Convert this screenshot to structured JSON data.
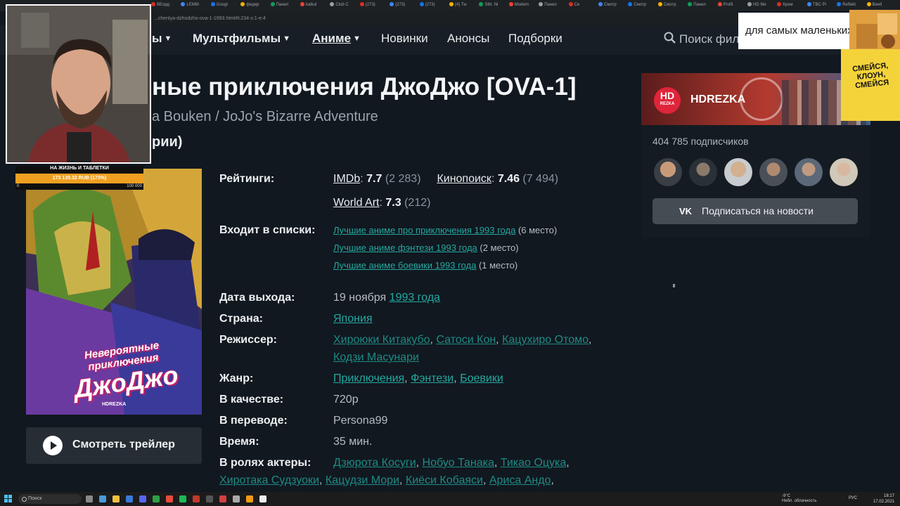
{
  "browser": {
    "tabs": [
      "ВЕорд",
      "LEMM",
      "Googl",
      "федер",
      "Панел",
      "kalkul",
      "Club C",
      "(273)",
      "(273)",
      "(273)",
      "(4) Tw",
      "Stllr. Ni",
      "Modern",
      "Панел",
      "Се",
      "Смотр",
      "Смотр",
      "Смотр",
      "Панел",
      "Profil",
      "HD Ме",
      "Крем",
      "TBC Pl",
      "Reflekt",
      "Beetl"
    ],
    "url": "...chenlya-dzhodzho-ova-1-1993.html#t:234-s:1-e:4"
  },
  "nav": {
    "item_cut": "ы",
    "cartoons": "Мультфильмы",
    "anime": "Аниме",
    "new": "Новинки",
    "announcements": "Анонсы",
    "collections": "Подборки",
    "search_placeholder": "Поиск фил"
  },
  "page": {
    "title": "ные приключения ДжоДжо [OVA-1]",
    "orig_title": "a Bouken / JoJo's Bizarre Adventure",
    "series": "рии)"
  },
  "poster": {
    "title_line1": "Невероятные",
    "title_line2": "приключения",
    "title_line3": "ДжоДжо",
    "watermark": "HDREZKA"
  },
  "trailer": {
    "label": "Смотреть трейлер"
  },
  "info": {
    "ratings_label": "Рейтинги:",
    "imdb": {
      "name": "IMDb",
      "score": "7.7",
      "votes": "(2 283)"
    },
    "kp": {
      "name": "Кинопоиск",
      "score": "7.46",
      "votes": "(7 494)"
    },
    "worldart": {
      "name": "World Art",
      "score": "7.3",
      "votes": "(212)"
    },
    "lists_label": "Входит в списки:",
    "lists": [
      {
        "title": "Лучшие аниме про приключения 1993 года",
        "place": "(6 место)"
      },
      {
        "title": "Лучшие аниме фэнтези 1993 года",
        "place": "(2 место)"
      },
      {
        "title": "Лучшие аниме боевики 1993 года",
        "place": "(1 место)"
      }
    ],
    "date_label": "Дата выхода:",
    "date_day": "19 ноября",
    "date_year": "1993 года",
    "country_label": "Страна:",
    "country": "Япония",
    "director_label": "Режиссер:",
    "directors": [
      "Хироюки Китакубо",
      "Сатоси Кон",
      "Кацухиро Отомо",
      "Кодзи Масунари"
    ],
    "genre_label": "Жанр:",
    "genres": [
      "Приключения",
      "Фэнтези",
      "Боевики"
    ],
    "quality_label": "В качестве:",
    "quality": "720p",
    "translation_label": "В переводе:",
    "translation": "Persona99",
    "time_label": "Время:",
    "time": "35 мин.",
    "actors_label": "В ролях актеры:",
    "actors": [
      "Дзюрота Косуги",
      "Нобуо Танака",
      "Тикао Оцука",
      "Хиротака Судзуоки",
      "Кацудзи Мори",
      "Киёси Кобаяси",
      "Ариса Андо"
    ]
  },
  "widget": {
    "logo_text": "HD",
    "logo_sub": "REZKA",
    "name": "HDREZKA",
    "subscribers": "404 785 подписчиков",
    "vk": "VK",
    "subscribe_button": "Подписаться на новости"
  },
  "overlay": {
    "donation_title": "НА ЖИЗНЬ И ТАБЛЕТКИ",
    "donation_amount": "173 139.32 RUB (173%)",
    "donation_progress": 1.0,
    "donation_min": "0",
    "donation_max": "100 000",
    "caption": "для самых маленьких",
    "sticker_text": "СМЕЙСЯ, КЛОУН, СМЕЙСЯ"
  },
  "taskbar": {
    "search": "Поиск",
    "weather_temp": "-9°C",
    "weather_desc": "Небл. облачность",
    "lang": "РУС",
    "time": "18:17",
    "date": "17.02.2021"
  },
  "colors": {
    "background": "#111820",
    "link": "#24a8a0",
    "accent_red": "#e0253a",
    "vk_button": "#454c54"
  }
}
